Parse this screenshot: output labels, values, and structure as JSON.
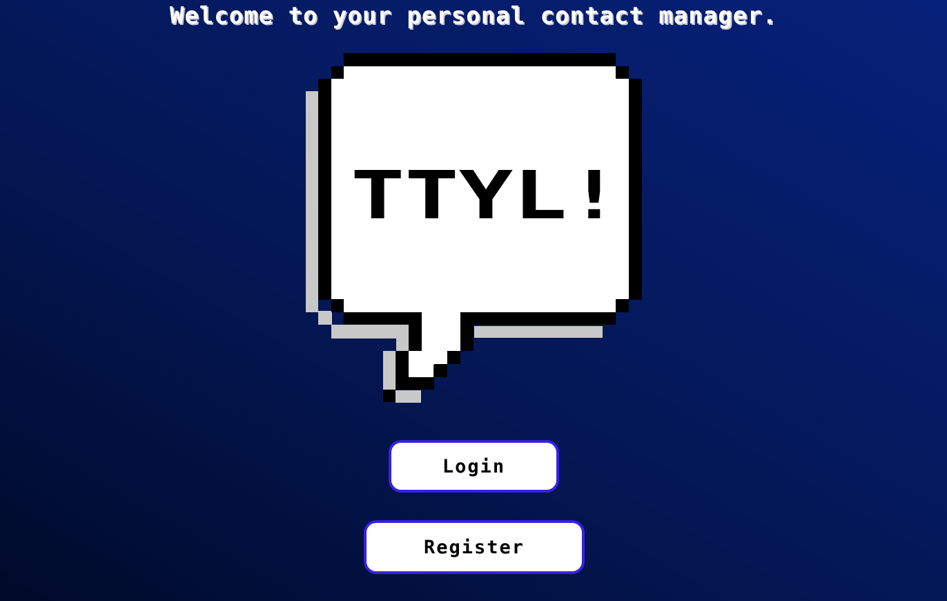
{
  "header": {
    "title": "Welcome to your personal contact manager."
  },
  "logo": {
    "text": "TTYL!",
    "icon": "speech-bubble-icon"
  },
  "actions": {
    "login_label": "Login",
    "register_label": "Register"
  },
  "colors": {
    "background_dark": "#000a2a",
    "background_light": "#06217a",
    "button_border": "#3622e0",
    "bubble_fill": "#ffffff",
    "bubble_outline": "#000000",
    "bubble_shadow": "#c8c8c8"
  }
}
